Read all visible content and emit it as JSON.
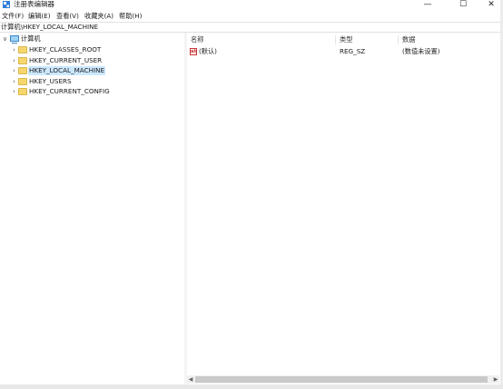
{
  "window": {
    "title": "注册表编辑器",
    "minimize_glyph": "—",
    "maximize_glyph": "☐",
    "close_glyph": "✕"
  },
  "menu": [
    "文件(F)",
    "编辑(E)",
    "查看(V)",
    "收藏夹(A)",
    "帮助(H)"
  ],
  "address": "计算机\\HKEY_LOCAL_MACHINE",
  "tree": {
    "root_label": "计算机",
    "root_expander": "∨",
    "child_expander": "›",
    "children": [
      "HKEY_CLASSES_ROOT",
      "HKEY_CURRENT_USER",
      "HKEY_LOCAL_MACHINE",
      "HKEY_USERS",
      "HKEY_CURRENT_CONFIG"
    ],
    "selected": "HKEY_LOCAL_MACHINE"
  },
  "list": {
    "columns": [
      "名称",
      "类型",
      "数据"
    ],
    "rows": [
      {
        "icon": "ab",
        "name": "(默认)",
        "type": "REG_SZ",
        "data": "(数值未设置)"
      }
    ]
  },
  "scrollbar": {
    "left_glyph": "◀",
    "right_glyph": "▶"
  },
  "colors": {
    "selection": "#cce8ff",
    "folder": "#f5d76e",
    "string_value_icon": "#cc3333"
  }
}
